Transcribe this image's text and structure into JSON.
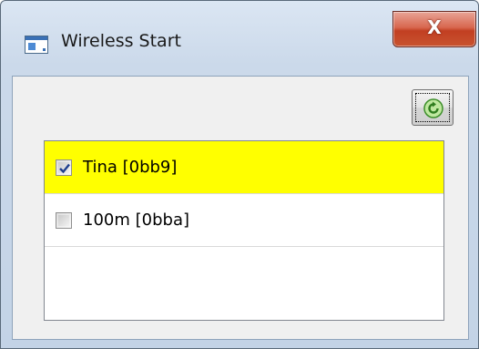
{
  "window": {
    "title": "Wireless Start",
    "close_label": "X"
  },
  "toolbar": {
    "refresh_icon": "refresh-icon"
  },
  "list": {
    "items": [
      {
        "label": "Tina [0bb9]",
        "checked": true,
        "selected": true,
        "highlight_color": "#ffff00"
      },
      {
        "label": "100m [0bba]",
        "checked": false,
        "selected": false
      }
    ]
  }
}
